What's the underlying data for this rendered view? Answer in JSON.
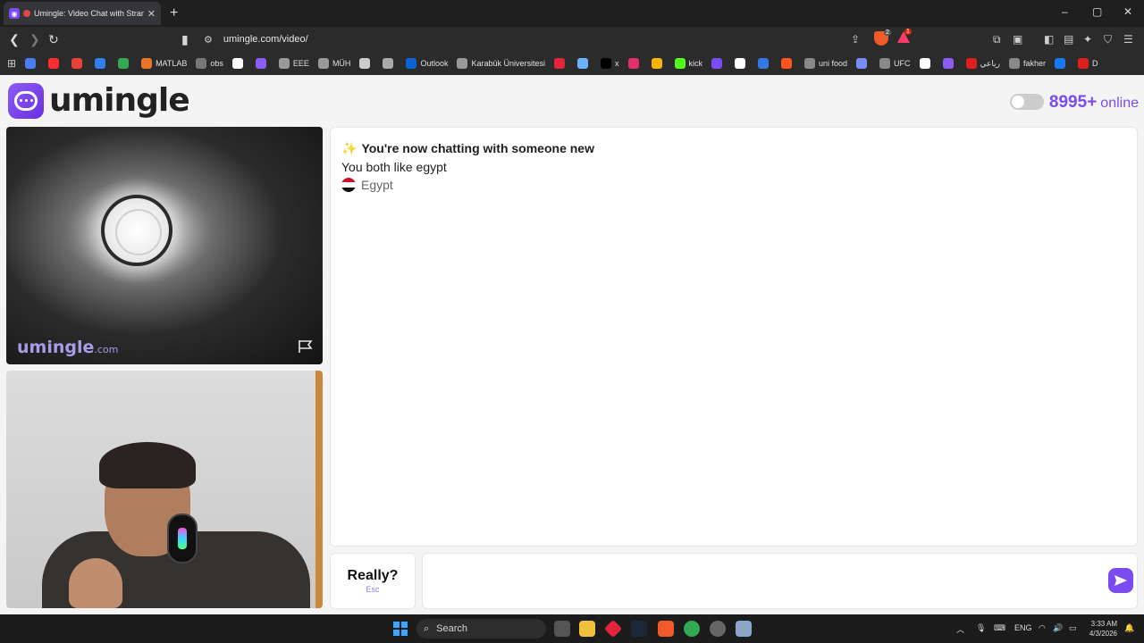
{
  "browser": {
    "tab_title": "Umingle: Video Chat with Strangers",
    "new_tab": "+",
    "url": "umingle.com/video/",
    "window_controls": [
      "–",
      "▢",
      "✕"
    ],
    "brave_badge": "2",
    "alert_badge": "1",
    "bookmarks": [
      {
        "label": "",
        "color": "#4a7df0"
      },
      {
        "label": "",
        "color": "#ff2d2d"
      },
      {
        "label": "",
        "color": "#ea4335"
      },
      {
        "label": "",
        "color": "#2f7ff0"
      },
      {
        "label": "",
        "color": "#34a853"
      },
      {
        "label": "MATLAB",
        "color": "#e8742a"
      },
      {
        "label": "obs",
        "color": "#777777"
      },
      {
        "label": "",
        "color": "#ffffff"
      },
      {
        "label": "",
        "color": "#8b5cf6"
      },
      {
        "label": "EEE",
        "color": "#999999"
      },
      {
        "label": "MÜH",
        "color": "#999999"
      },
      {
        "label": "",
        "color": "#cccccc"
      },
      {
        "label": "",
        "color": "#aaaaaa"
      },
      {
        "label": "Outlook",
        "color": "#0a64d6"
      },
      {
        "label": "Karabük Üniversitesi",
        "color": "#999999"
      },
      {
        "label": "",
        "color": "#e2243b"
      },
      {
        "label": "",
        "color": "#6ab3ff"
      },
      {
        "label": "x",
        "color": "#000000"
      },
      {
        "label": "",
        "color": "#e1306c"
      },
      {
        "label": "",
        "color": "#f7b500"
      },
      {
        "label": "kick",
        "color": "#53fc18"
      },
      {
        "label": "",
        "color": "#7b4cf5"
      },
      {
        "label": "",
        "color": "#ffffff"
      },
      {
        "label": "",
        "color": "#3578e5"
      },
      {
        "label": "",
        "color": "#ff5722"
      },
      {
        "label": "uni food",
        "color": "#888888"
      },
      {
        "label": "",
        "color": "#7b8cf5"
      },
      {
        "label": "UFC",
        "color": "#888888"
      },
      {
        "label": "",
        "color": "#ffffff"
      },
      {
        "label": "",
        "color": "#8b5cf6"
      },
      {
        "label": "رياعي",
        "color": "#e02020"
      },
      {
        "label": "fakher",
        "color": "#888888"
      },
      {
        "label": "",
        "color": "#1877f2"
      },
      {
        "label": "D",
        "color": "#e02020"
      }
    ]
  },
  "header": {
    "logo_text": "umingle",
    "online_count": "8995+",
    "online_label": "online"
  },
  "stranger_video": {
    "watermark_brand": "umingle",
    "watermark_domain": ".com"
  },
  "chat": {
    "line1": "You're now chatting with someone new",
    "line2": "You both like egypt",
    "country": "Egypt"
  },
  "controls": {
    "skip_label": "Really?",
    "skip_sub": "Esc",
    "input_value": "",
    "input_placeholder": ""
  },
  "taskbar": {
    "search_label": "Search",
    "lang": "ENG",
    "time": "3:33 AM",
    "date": "4/3/2026"
  },
  "colors": {
    "accent": "#7a4cf0"
  }
}
